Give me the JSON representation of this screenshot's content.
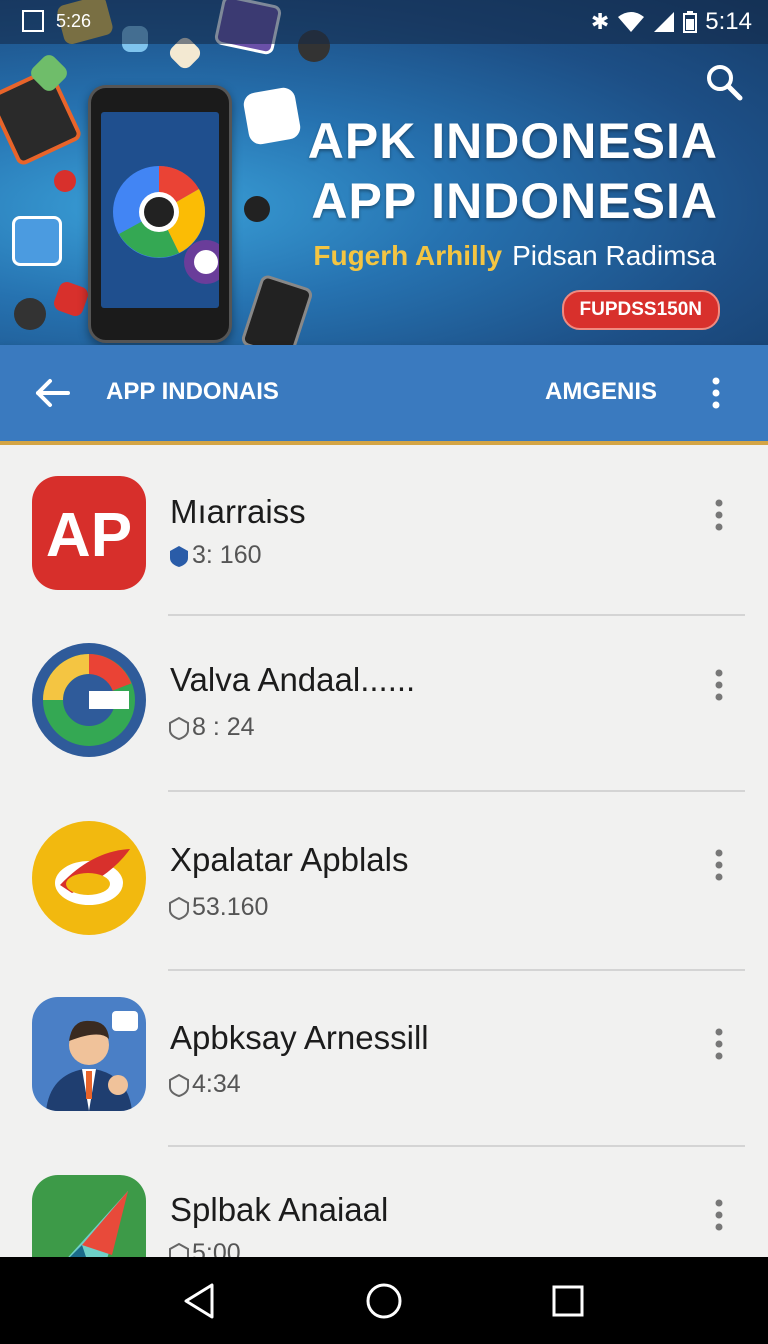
{
  "status_bar": {
    "left_text": "5:26",
    "time": "5:14"
  },
  "banner": {
    "title_line1": "APK INDONESIA",
    "title_line2": "APP INDONESIA",
    "subtitle_accent": "Fugerh Arhilly",
    "subtitle": "Pidsan Radimsa",
    "badge": "FUPDSS150N",
    "colors": {
      "accent": "#f4c542",
      "badge": "#d8302c"
    }
  },
  "app_bar": {
    "title": "APP INDONAIS",
    "action": "AMGENIS"
  },
  "apps": [
    {
      "name": "Mıarraiss",
      "meta": "3: 160",
      "icon": "ap-icon",
      "color": "#d72f2b"
    },
    {
      "name": "Valva Andaal......",
      "meta": "8 : 24",
      "icon": "g-icon",
      "color": "#2f5b9a"
    },
    {
      "name": "Xpalatar Apblals",
      "meta": "53.160",
      "icon": "feather-icon",
      "color": "#f2b90f"
    },
    {
      "name": "Apbksay Arnessill",
      "meta": "4:34",
      "icon": "businessman-icon",
      "color": "#4a7fc6"
    },
    {
      "name": "Splbak Anaiaal",
      "meta": "5:00",
      "icon": "arrow-icon",
      "color": "#3d9a48"
    }
  ]
}
